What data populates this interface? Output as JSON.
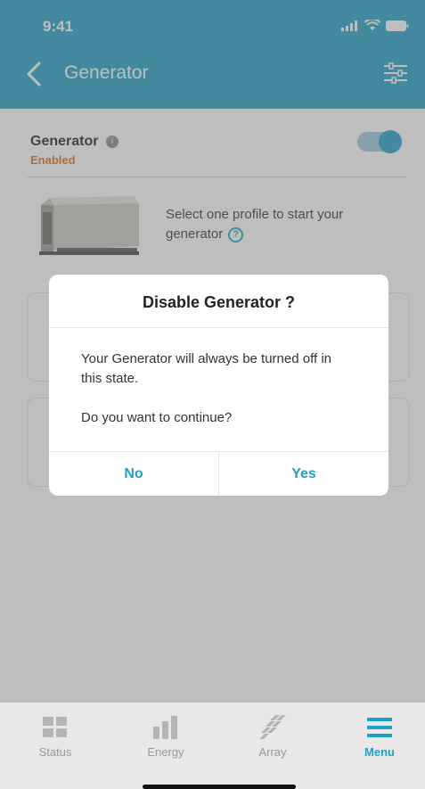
{
  "status_bar": {
    "time": "9:41"
  },
  "header": {
    "title": "Generator"
  },
  "generator": {
    "label": "Generator",
    "status": "Enabled",
    "toggle_on": true
  },
  "profile": {
    "prompt": "Select one profile to start your generator"
  },
  "modal": {
    "title": "Disable Generator ?",
    "message": "Your Generator will always be turned off in this state.",
    "question": "Do you want to continue?",
    "no_label": "No",
    "yes_label": "Yes"
  },
  "tabs": [
    {
      "label": "Status",
      "icon": "grid-icon"
    },
    {
      "label": "Energy",
      "icon": "bar-chart-icon"
    },
    {
      "label": "Array",
      "icon": "array-icon"
    },
    {
      "label": "Menu",
      "icon": "menu-icon",
      "active": true
    }
  ],
  "colors": {
    "accent": "#1fa0c9",
    "enabled": "#e06a1b",
    "header": "#1fa0c9"
  }
}
